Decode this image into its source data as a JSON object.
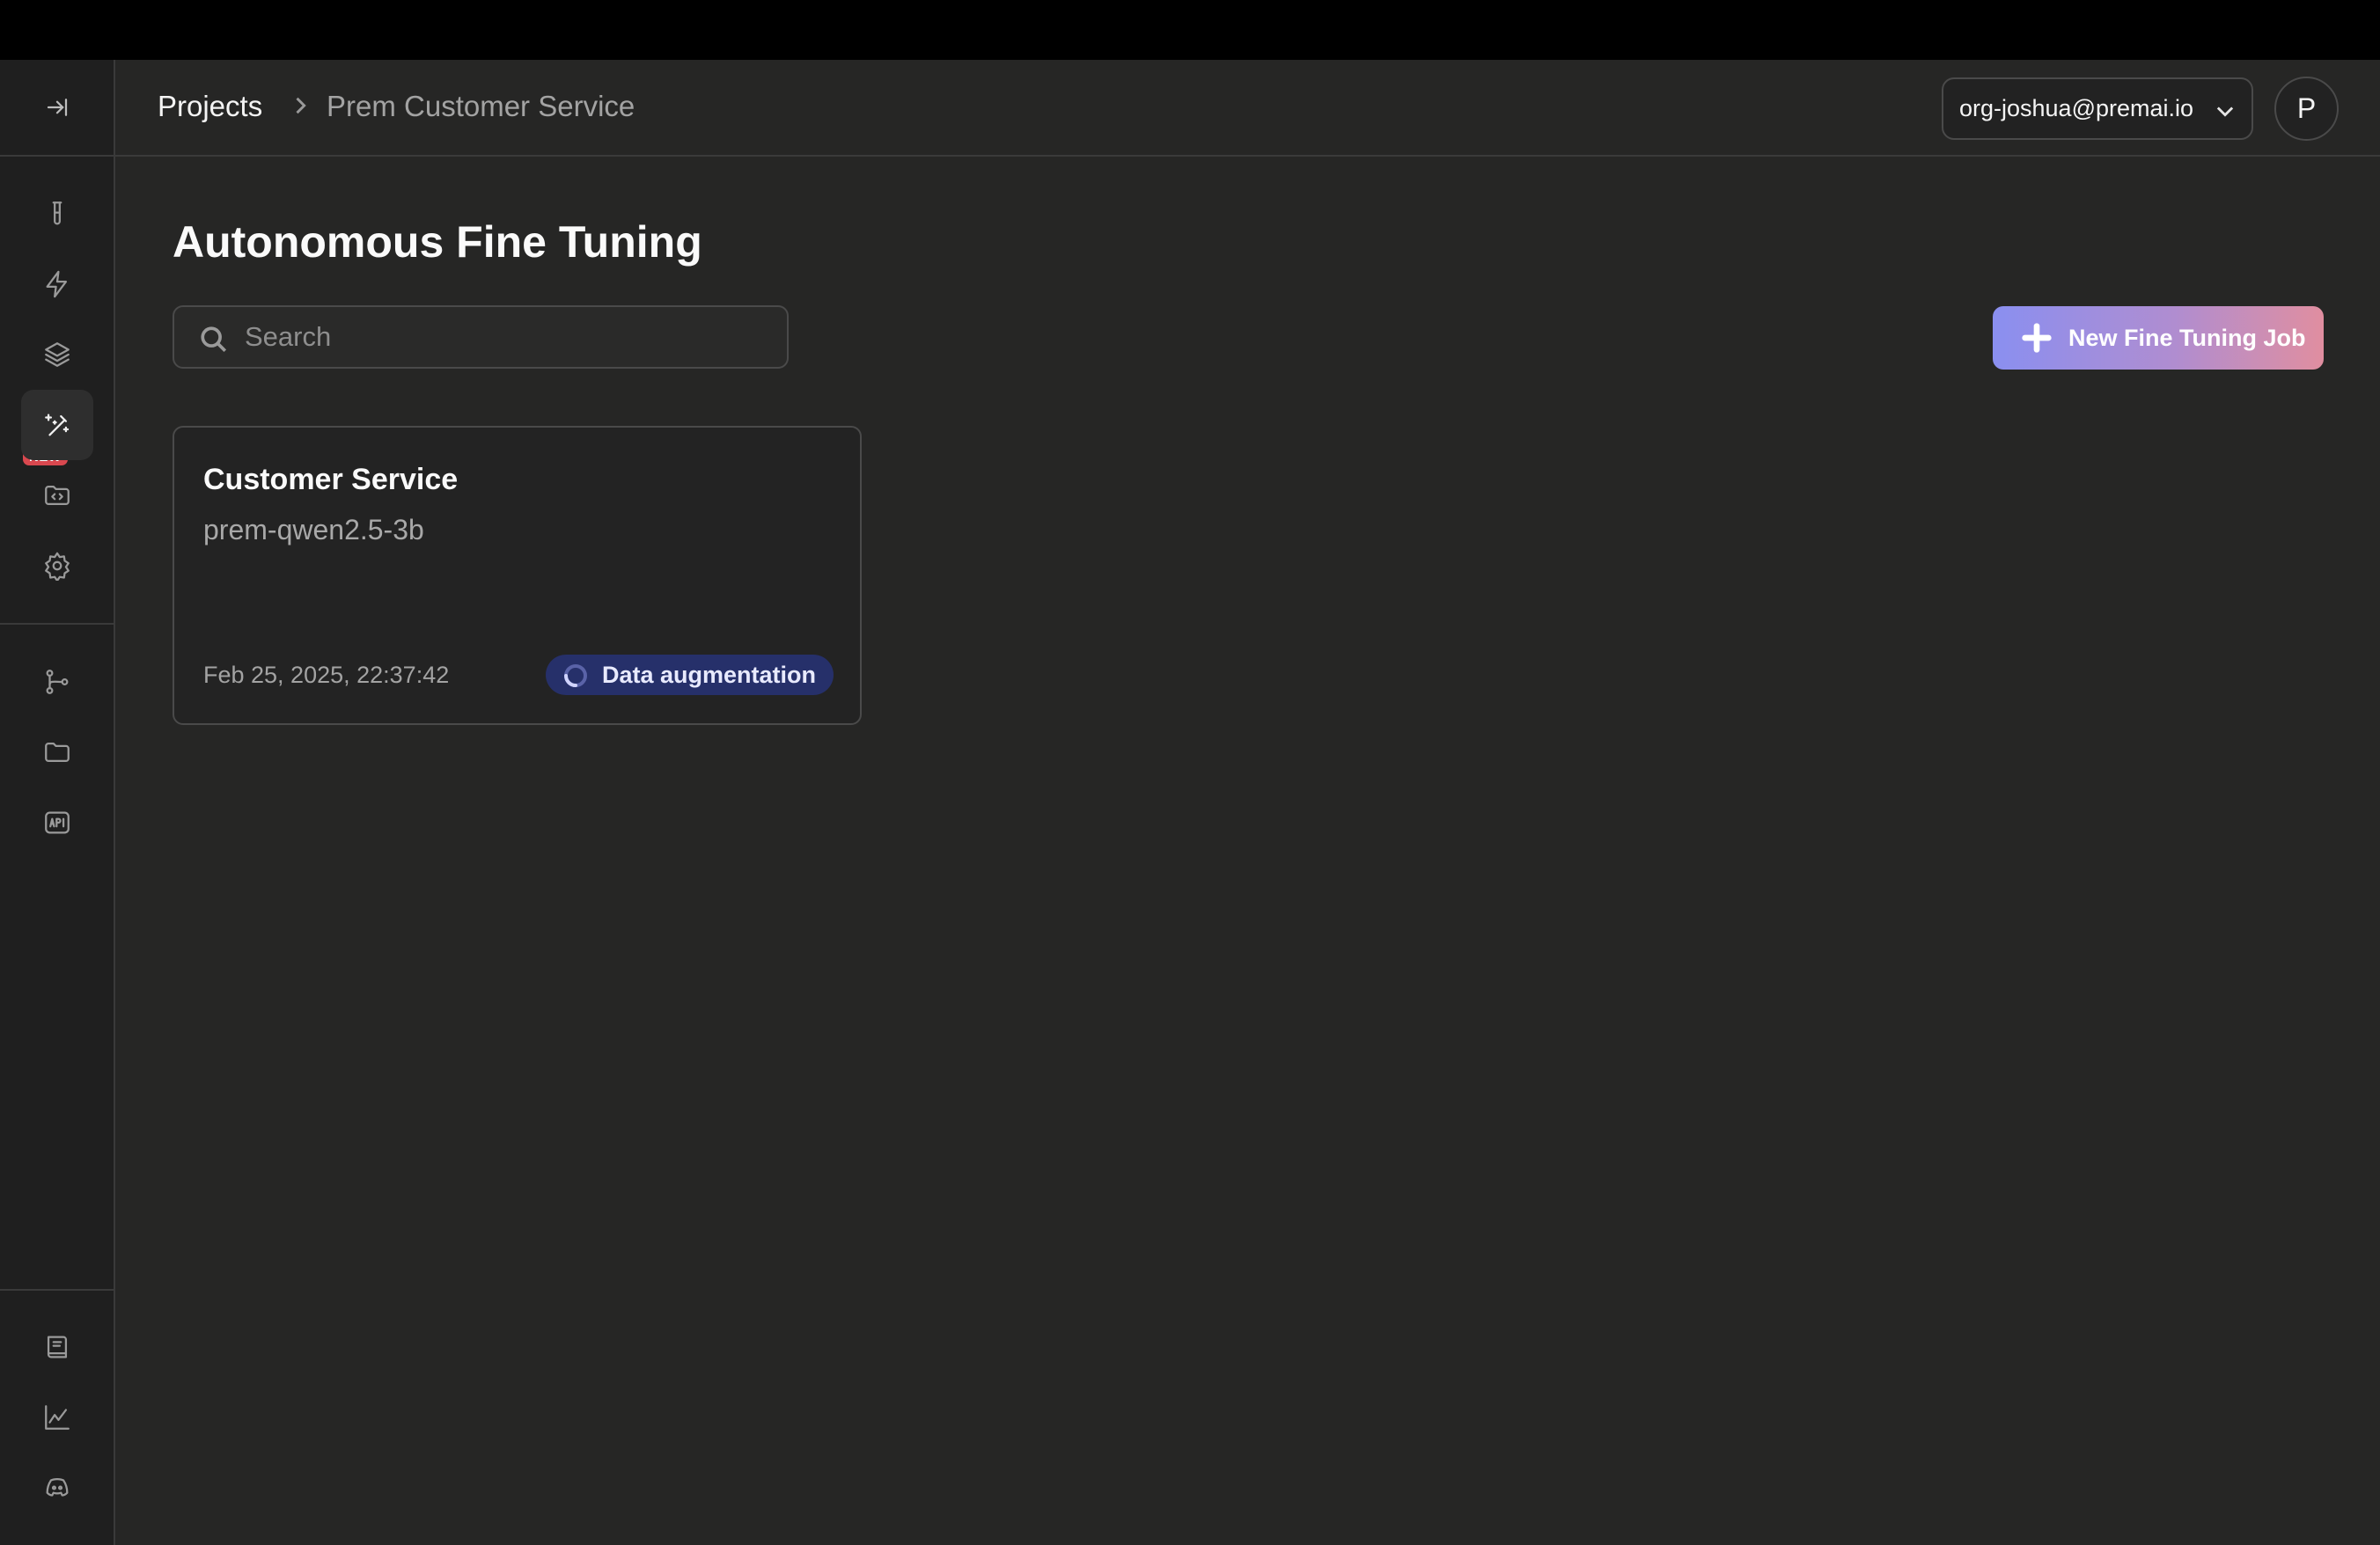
{
  "breadcrumb": {
    "root": "Projects",
    "current": "Prem Customer Service"
  },
  "org_selector": {
    "value": "org-joshua@premai.io"
  },
  "avatar": {
    "initial": "P"
  },
  "sidebar": {
    "new_badge": "NEW",
    "items": [
      {
        "icon": "test-tube-icon"
      },
      {
        "icon": "lightning-icon"
      },
      {
        "icon": "layers-icon"
      },
      {
        "icon": "magic-wand-icon",
        "active": true
      },
      {
        "icon": "code-folder-icon"
      },
      {
        "icon": "gear-icon"
      },
      {
        "icon": "git-branch-icon"
      },
      {
        "icon": "folder-icon"
      },
      {
        "icon": "api-icon"
      },
      {
        "icon": "docs-book-icon"
      },
      {
        "icon": "line-chart-icon"
      },
      {
        "icon": "discord-icon"
      }
    ]
  },
  "main": {
    "title": "Autonomous Fine Tuning",
    "search": {
      "placeholder": "Search",
      "value": ""
    },
    "new_job_button": "New Fine Tuning Job",
    "jobs": [
      {
        "name": "Customer Service",
        "model": "prem-qwen2.5-3b",
        "created": "Feb 25, 2025, 22:37:42",
        "status": "Data augmentation"
      }
    ]
  },
  "colors": {
    "background": "#262625",
    "sidebar": "#1f1f1f",
    "status_badge_bg": "#26306a",
    "new_badge": "#d9484f",
    "button_gradient_start": "#8a8ff0",
    "button_gradient_end": "#e08ea0"
  }
}
